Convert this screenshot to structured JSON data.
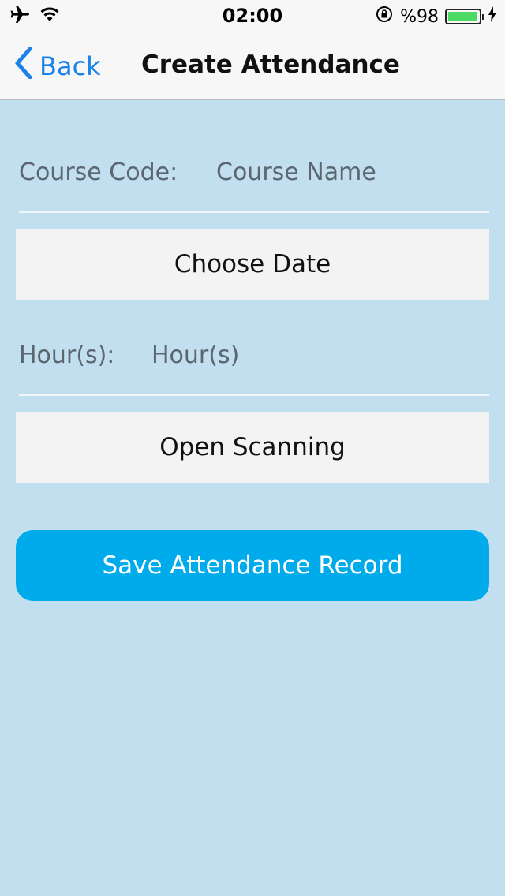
{
  "status_bar": {
    "time": "02:00",
    "battery_text": "%98",
    "battery_level": 0.98,
    "icons": [
      "airplane-icon",
      "wifi-icon",
      "rotation-lock-icon",
      "battery-icon",
      "charging-bolt-icon"
    ]
  },
  "nav": {
    "back_label": "Back",
    "title": "Create Attendance"
  },
  "form": {
    "course_label": "Course Code:",
    "course_value": "Course Name",
    "choose_date_label": "Choose Date",
    "hours_label": "Hour(s):",
    "hours_value": "Hour(s)",
    "open_scanning_label": "Open Scanning",
    "save_label": "Save Attendance Record"
  },
  "colors": {
    "background": "#c2dfef",
    "accent": "#1a82e8",
    "primary_button": "#00abeb",
    "battery": "#4cd964"
  }
}
